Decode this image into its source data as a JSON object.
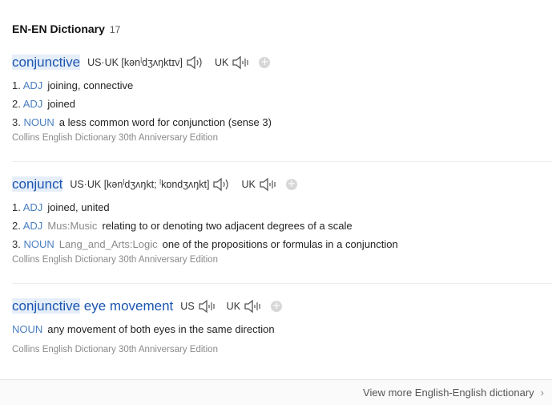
{
  "header": {
    "title": "EN-EN Dictionary",
    "count": "17"
  },
  "entries": [
    {
      "word_hl": "conjunctive",
      "word_rest": "",
      "pron_label": "US·UK [kən",
      "pron_rest": "dʒʌŋktɪv]",
      "uk_label": "UK",
      "senses": [
        {
          "num": "1.",
          "pos": "ADJ",
          "field": "",
          "text": "joining, connective"
        },
        {
          "num": "2.",
          "pos": "ADJ",
          "field": "",
          "text": "joined"
        },
        {
          "num": "3.",
          "pos": "NOUN",
          "field": "",
          "text": "a less common word for conjunction (sense 3)"
        }
      ],
      "source": "Collins English Dictionary 30th Anniversary Edition"
    },
    {
      "word_hl": "conjunct",
      "word_rest": "",
      "pron_label": "US·UK [kən",
      "pron_rest": "dʒʌŋkt; ",
      "pron_rest2": "kɒndʒʌŋkt]",
      "uk_label": "UK",
      "senses": [
        {
          "num": "1.",
          "pos": "ADJ",
          "field": "",
          "text": "joined, united"
        },
        {
          "num": "2.",
          "pos": "ADJ",
          "field": "Mus:Music",
          "text": "relating to or denoting two adjacent degrees of a scale"
        },
        {
          "num": "3.",
          "pos": "NOUN",
          "field": "Lang_and_Arts:Logic",
          "text": "one of the propositions or formulas in a conjunction"
        }
      ],
      "source": "Collins English Dictionary 30th Anniversary Edition"
    },
    {
      "word_hl": "conjunctive",
      "word_rest": " eye movement",
      "us_label": "US",
      "uk_label": "UK",
      "senses": [
        {
          "pos": "NOUN",
          "text": "any movement of both eyes in the same direction"
        }
      ],
      "source": "Collins English Dictionary 30th Anniversary Edition"
    }
  ],
  "footer": {
    "more_label": "View more English-English dictionary",
    "chevron": "›"
  }
}
